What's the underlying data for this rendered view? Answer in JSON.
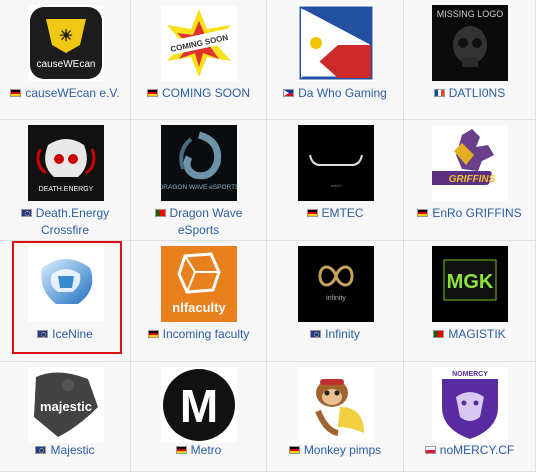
{
  "teams": [
    {
      "name": "causeWEcan e.V.",
      "flag": "de",
      "logo_text": "causeWEcan"
    },
    {
      "name": "COMING SOON",
      "flag": "de",
      "logo_text": "COMING SOON"
    },
    {
      "name": "Da Who Gaming",
      "flag": "ph",
      "logo_text": ""
    },
    {
      "name": "DATLI0NS",
      "flag": "fr",
      "logo_text": "MISSING LOGO"
    },
    {
      "name": "Death.Energy Crossfire",
      "flag": "eu",
      "logo_text": "DEATH.ENERGY"
    },
    {
      "name": "Dragon Wave eSports",
      "flag": "pt",
      "logo_text": "DRAGON WAVE eSPORTS"
    },
    {
      "name": "EMTEC",
      "flag": "de",
      "logo_text": ""
    },
    {
      "name": "EnRo GRIFFINS",
      "flag": "de",
      "logo_text": "GRIFFINS"
    },
    {
      "name": "IceNine",
      "flag": "eu",
      "logo_text": ""
    },
    {
      "name": "Incoming faculty",
      "flag": "de",
      "logo_text": "nlfaculty"
    },
    {
      "name": "Infinity",
      "flag": "eu",
      "logo_text": "infinity"
    },
    {
      "name": "MAGISTIK",
      "flag": "pt",
      "logo_text": "MGK"
    },
    {
      "name": "Majestic",
      "flag": "eu",
      "logo_text": "majestic"
    },
    {
      "name": "Metro",
      "flag": "de",
      "logo_text": "M"
    },
    {
      "name": "Monkey pimps",
      "flag": "de",
      "logo_text": ""
    },
    {
      "name": "noMERCY.CF",
      "flag": "pl",
      "logo_text": "NOMERCY"
    }
  ],
  "selected_team": "IceNine",
  "colors": {
    "link": "#2b5da1",
    "selection": "#dd1111",
    "cell_bg": "#f7f7f7"
  }
}
